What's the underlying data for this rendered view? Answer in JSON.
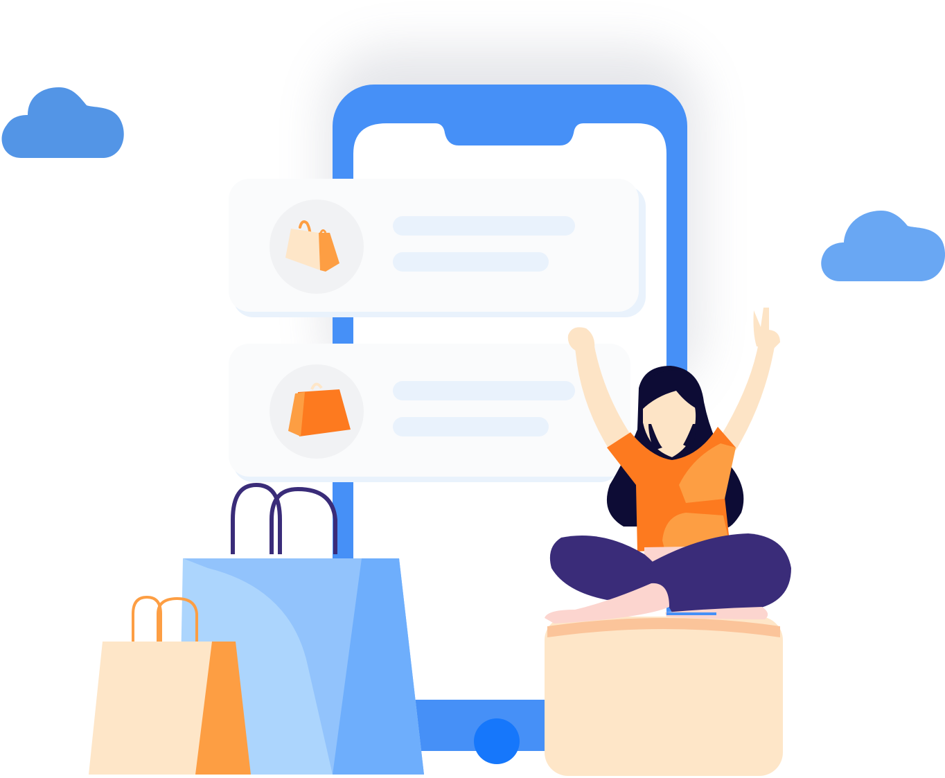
{
  "illustration": {
    "theme": "online-shopping",
    "colors": {
      "phone_blue": "#4690f7",
      "home_button": "#1677fb",
      "cloud_left": "#5395e6",
      "cloud_right": "#69a7f3",
      "card_bg": "#fafbfc",
      "line_placeholder": "#e9f2fc",
      "orange": "#fd7a1f",
      "orange_light": "#fd9e43",
      "cream": "#fee6c8",
      "navy": "#3a2c79",
      "hair": "#0d0c35",
      "skin": "#fde4c6"
    },
    "cards": [
      {
        "icon": "shopping-bag-light-icon"
      },
      {
        "icon": "shopping-bag-orange-icon"
      }
    ],
    "icons": [
      "cloud-icon",
      "shopping-bag-icon",
      "smartphone-icon",
      "person-celebrating"
    ]
  }
}
